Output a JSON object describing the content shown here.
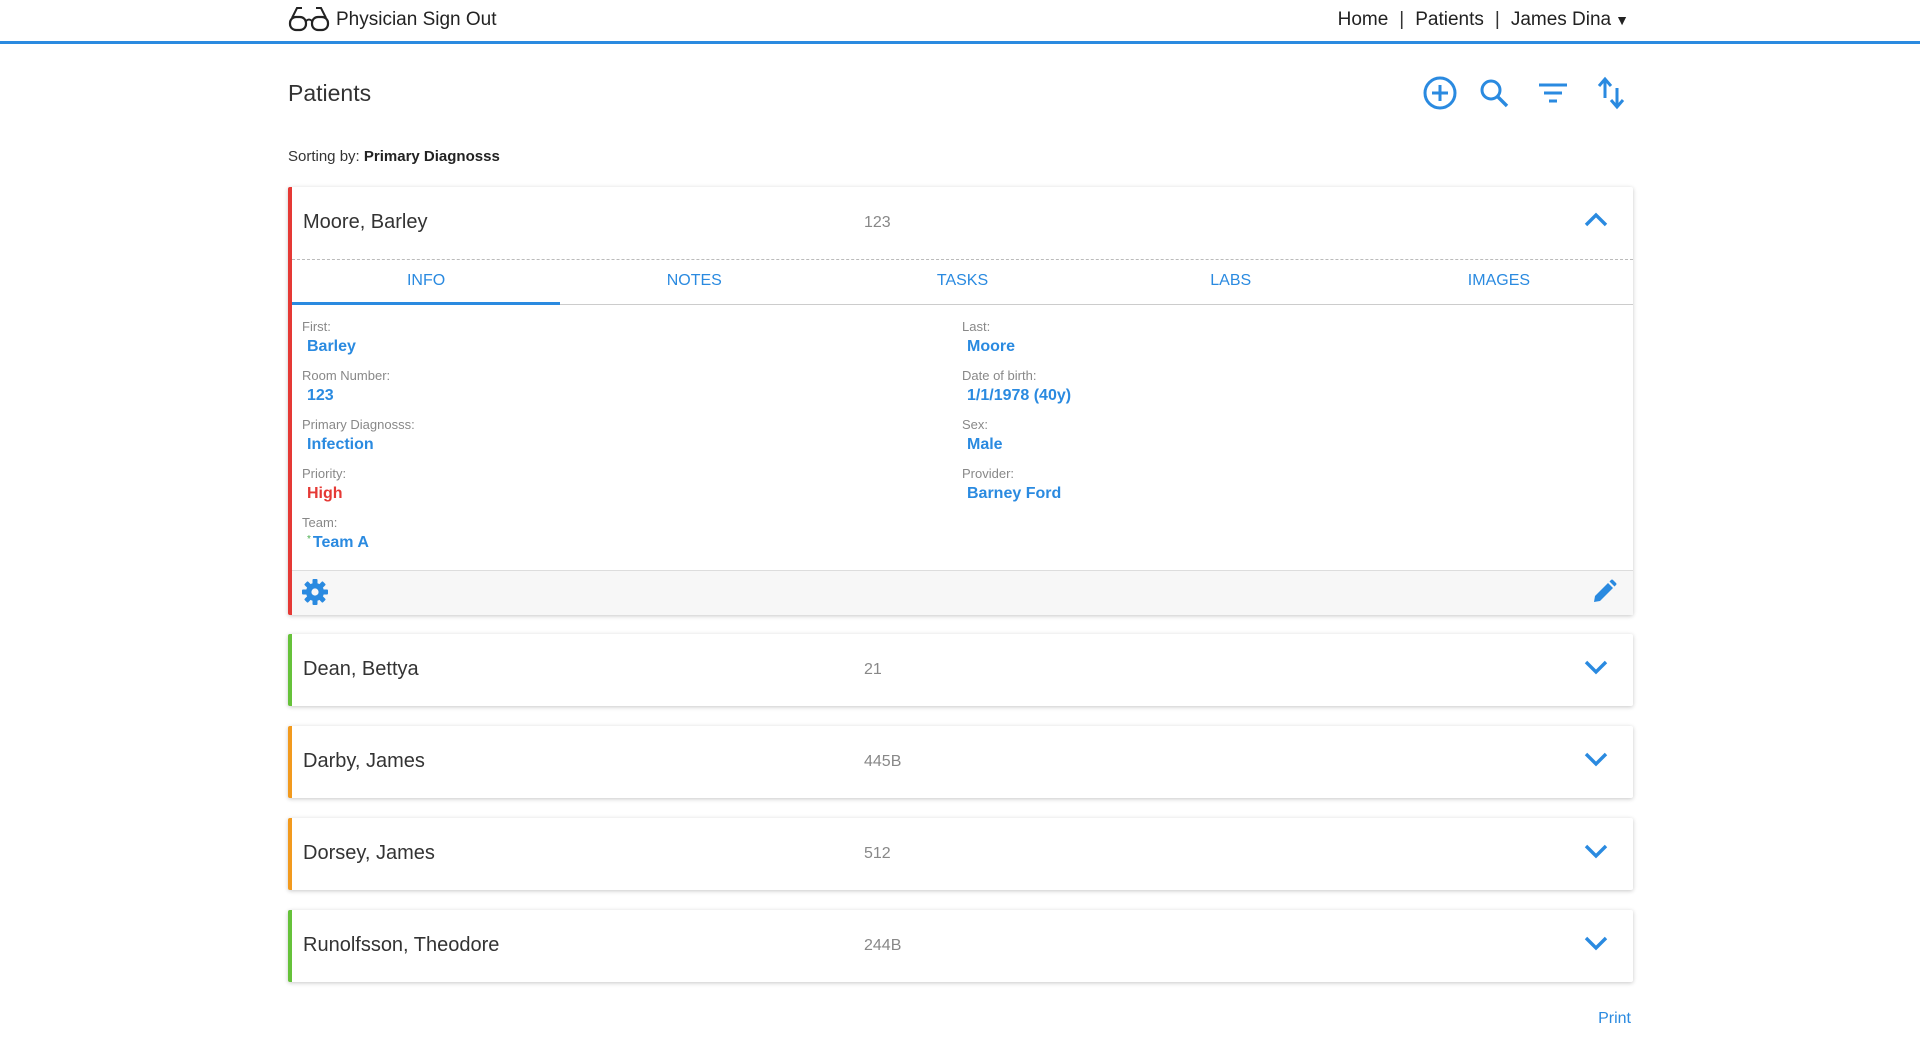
{
  "app": {
    "brand": "Physician Sign Out",
    "brand_icon": "glasses-icon"
  },
  "nav": {
    "home": "Home",
    "patients": "Patients",
    "user": "James Dina",
    "separator": "|"
  },
  "page": {
    "title": "Patients",
    "sort_label": "Sorting by:",
    "sort_value": "Primary Diagnosss",
    "print_label": "Print"
  },
  "toolbar": [
    "add-circle-icon",
    "search-icon",
    "filter-icon",
    "sort-icon"
  ],
  "colors": {
    "accent": "#2a8ae0",
    "priority_high": "#e53935",
    "priority_low": "#66c23a",
    "priority_medium": "#f29a1e"
  },
  "patients": [
    {
      "name": "Moore, Barley",
      "room": "123",
      "expanded": true,
      "status_color": "#e53935"
    },
    {
      "name": "Dean, Bettya",
      "room": "21",
      "expanded": false,
      "status_color": "#66c23a"
    },
    {
      "name": "Darby, James",
      "room": "445B",
      "expanded": false,
      "status_color": "#f29a1e"
    },
    {
      "name": "Dorsey, James",
      "room": "512",
      "expanded": false,
      "status_color": "#f29a1e"
    },
    {
      "name": "Runolfsson, Theodore",
      "room": "244B",
      "expanded": false,
      "status_color": "#66c23a"
    }
  ],
  "detail": {
    "tabs": [
      "INFO",
      "NOTES",
      "TASKS",
      "LABS",
      "IMAGES"
    ],
    "active_tab": "INFO",
    "fields": {
      "first": {
        "label": "First:",
        "value": "Barley"
      },
      "last": {
        "label": "Last:",
        "value": "Moore"
      },
      "room": {
        "label": "Room Number:",
        "value": "123"
      },
      "dob": {
        "label": "Date of birth:",
        "value": "1/1/1978 (40y)"
      },
      "diagnosis": {
        "label": "Primary Diagnosss:",
        "value": "Infection"
      },
      "sex": {
        "label": "Sex:",
        "value": "Male"
      },
      "priority": {
        "label": "Priority:",
        "value": "High"
      },
      "provider": {
        "label": "Provider:",
        "value": "Barney Ford"
      },
      "team": {
        "label": "Team:",
        "value": "Team A",
        "marker": "*"
      }
    }
  }
}
